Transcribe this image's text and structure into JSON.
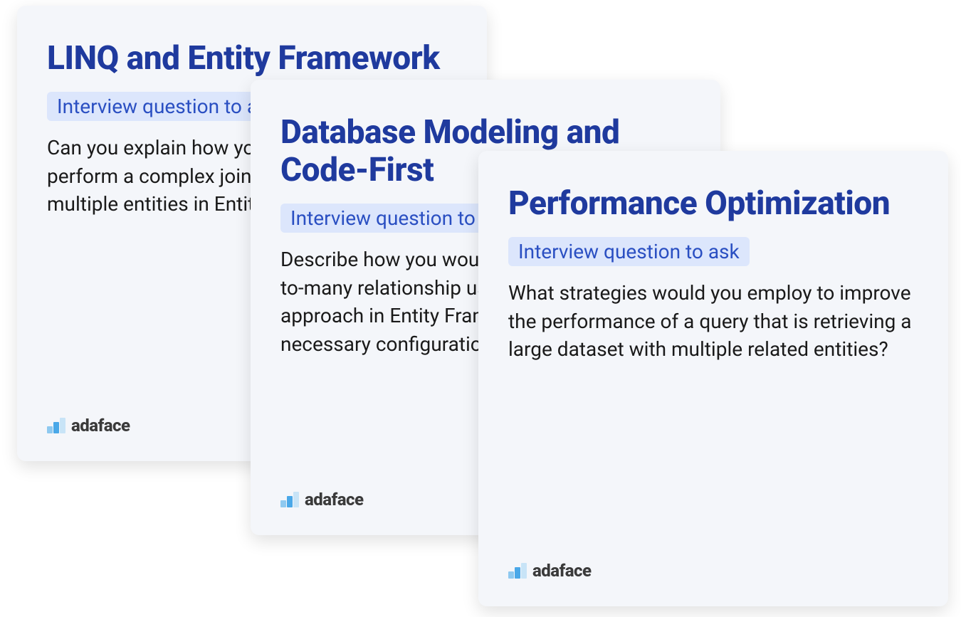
{
  "cards": [
    {
      "title": "LINQ and Entity Framework",
      "badge": "Interview question to ask",
      "body": "Can you explain how you would use LINQ to perform a complex join operation across multiple entities in Entity Framework?"
    },
    {
      "title": "Database Modeling and Code-First",
      "badge": "Interview question to ask",
      "body": "Describe how you would implement a many-to-many relationship using Code-First approach in Entity Framework, including any necessary configurations or attributes."
    },
    {
      "title": "Performance Optimization",
      "badge": "Interview question to ask",
      "body": "What strategies would you employ to improve the performance of a query that is retrieving a large dataset with multiple related entities?"
    }
  ],
  "logo": {
    "text": "adaface"
  }
}
